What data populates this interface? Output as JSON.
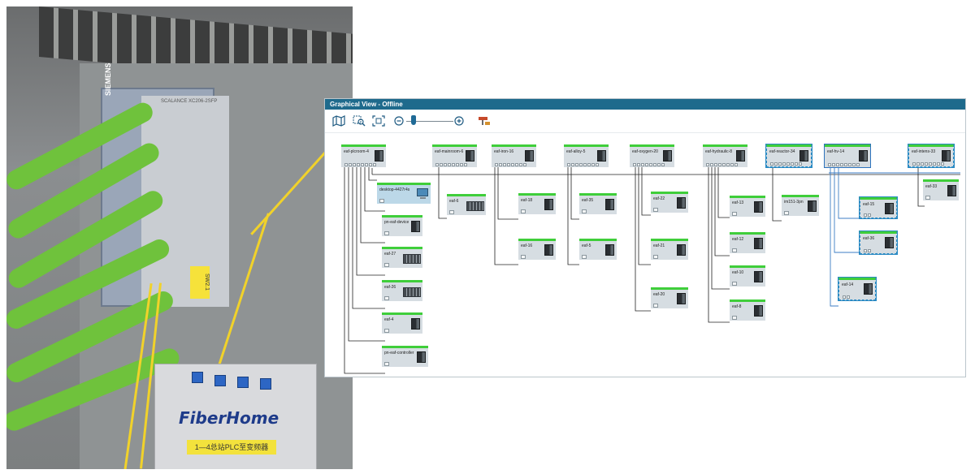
{
  "photo": {
    "switch_brand": "SIEMENS",
    "switch_model": "SCALANCE XC206-2SFP",
    "box_brand": "FiberHome",
    "box_label": "1—4总站PLC至变频器",
    "switch_tag": "SW2.1"
  },
  "window": {
    "title": "Graphical View - Offline"
  },
  "toolbar": {
    "icons": [
      "map-icon",
      "zoom-selection-icon",
      "fit-view-icon",
      "zoom-out-icon",
      "zoom-in-icon",
      "network-overview-icon"
    ],
    "zoom_level": 0.15
  },
  "devices": {
    "plcroom": "eaf-plcroom-4",
    "mainroom": "eaf-mainroom-6",
    "iron": "eaf-iron-16",
    "alloy": "eaf-alloy-5",
    "oxygen": "eaf-oxygen-20",
    "hydraulic": "eaf-hydraulic-8",
    "reactor": "eaf-reactor-34",
    "hv": "eaf-hv-14",
    "intens": "eaf-intens-33",
    "desktop": "desktop-4427r4s",
    "pn_device": "pn-eaf-device",
    "e27": "eaf-27",
    "e26": "eaf-26",
    "e4": "eaf-4",
    "pn_controller": "pn-eaf-controller",
    "e6": "eaf-6",
    "e18": "eaf-18",
    "e16": "eaf-16",
    "e35": "eaf-35",
    "e5": "eaf-5",
    "e22": "eaf-22",
    "e21": "eaf-21",
    "e20": "eaf-20",
    "e13": "eaf-13",
    "e12": "eaf-12",
    "e10": "eaf-10",
    "e8": "eaf-8",
    "rtu": "im151-3pn",
    "e15": "eaf-15",
    "e36": "eaf-36",
    "e14": "eaf-14",
    "e33": "eaf-33"
  }
}
